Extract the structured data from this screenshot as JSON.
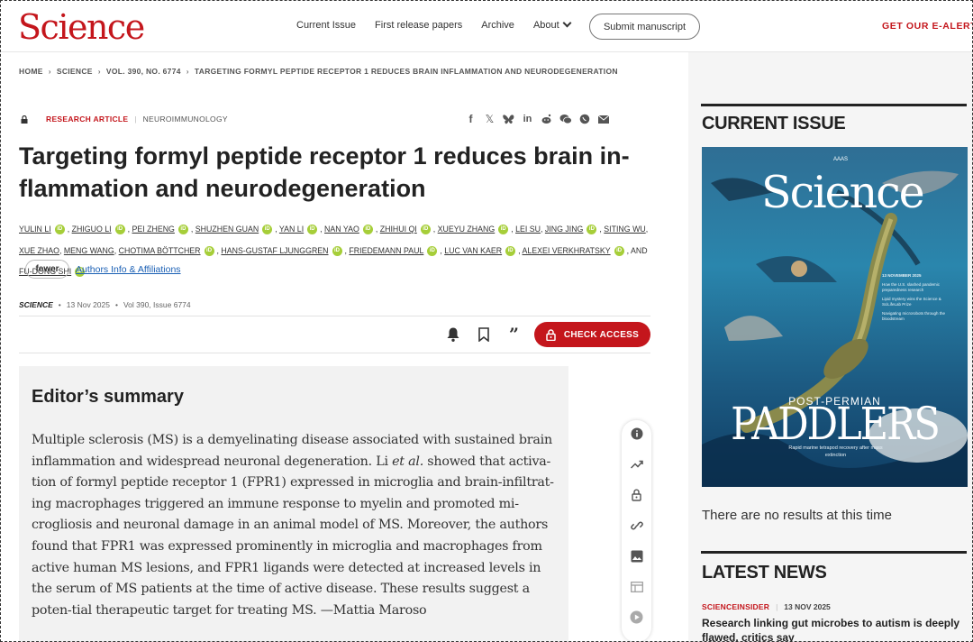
{
  "header": {
    "logo": "Science",
    "nav": [
      "Current Issue",
      "First release papers",
      "Archive"
    ],
    "about": "About",
    "submit": "Submit manuscript",
    "ealerts": "GET OUR E-ALERTS"
  },
  "breadcrumb": [
    "HOME",
    "SCIENCE",
    "VOL. 390, NO. 6774",
    "TARGETING FORMYL PEPTIDE RECEPTOR 1 REDUCES BRAIN INFLAMMATION AND NEURODEGENERATION"
  ],
  "article": {
    "type": "RESEARCH ARTICLE",
    "subject": "NEUROIMMUNOLOGY",
    "title": "Targeting formyl peptide receptor 1 reduces brain in-flammation and neurodegeneration",
    "authors": [
      "YULIN LI",
      "ZHIGUO LI",
      "PEI ZHENG",
      "SHUZHEN GUAN",
      "YAN LI",
      "NAN YAO",
      "ZHIHUI QI",
      "XUEYU ZHANG",
      "LEI SU",
      "JING JING",
      "SITING WU",
      "XUE ZHAO",
      "MENG WANG",
      "CHOTIMA BÖTTCHER",
      "HANS-GUSTAF LJUNGGREN",
      "FRIEDEMANN PAUL",
      "LUC VAN KAER",
      "ALEXEI VERKHRATSKY",
      "FU-DONG SHI"
    ],
    "and_text": ", AND",
    "fewer": "fewer",
    "affiliations": "Authors Info & Affiliations",
    "journal": "SCIENCE",
    "date": "13 Nov 2025",
    "volume": "Vol 390, Issue 6774",
    "check_access": "CHECK ACCESS"
  },
  "summary": {
    "heading": "Editor’s summary",
    "text_before": "Multiple sclerosis (MS) is a demyelinating disease associated with sustained brain inflammation and widespread neuronal degeneration. Li ",
    "text_italic": "et al.",
    "text_after": " showed that activa-tion of formyl peptide receptor 1 (FPR1) expressed in microglia and brain-infiltrat-ing macrophages triggered an immune response to myelin and promoted mi-crogliosis and neuronal damage in an animal model of MS. Moreover, the authors found that FPR1 was expressed prominently in microglia and macrophages from active human MS lesions, and FPR1 ligands were detected at increased levels in the serum of MS patients at the time of active disease. These results suggest a poten-tial therapeutic target for treating MS. —Mattia Maroso"
  },
  "sidebar": {
    "current_issue": "CURRENT ISSUE",
    "cover_logo": "Science",
    "cover_aaas": "AAAS",
    "cover_date": "13 NOVEMBER 2025",
    "cover_blurbs": [
      "How the U.S. slashed pandemic preparedness research",
      "Lipid mystery wins the Science & SciLifeLab Prize",
      "Navigating microrobots through the bloodstream"
    ],
    "cover_kicker": "POST-PERMIAN",
    "cover_headline": "PADDLERS",
    "cover_sub": "Rapid marine tetrapod recovery after mass extinction",
    "no_results": "There are no results at this time",
    "latest_news": "LATEST NEWS",
    "news_source": "SCIENCEINSIDER",
    "news_date": "13 NOV 2025",
    "news_title": "Research linking gut microbes to autism is deeply flawed, critics say"
  },
  "colors": {
    "brand": "#c4161c",
    "orcid": "#a6ce39",
    "link": "#1a5fb4"
  },
  "icons": [
    "facebook-icon",
    "x-icon",
    "bluesky-icon",
    "linkedin-icon",
    "reddit-icon",
    "wechat-icon",
    "whatsapp-icon",
    "email-icon",
    "bell-icon",
    "bookmark-icon",
    "quote-icon",
    "lock-icon",
    "info-icon",
    "trend-icon",
    "unlock-icon",
    "link-icon",
    "image-icon",
    "table-icon",
    "play-icon"
  ]
}
